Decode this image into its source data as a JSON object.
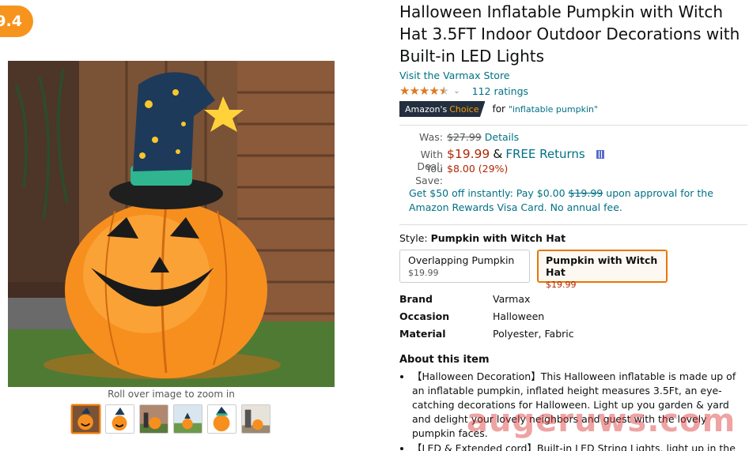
{
  "badge": {
    "score": "9.4"
  },
  "product": {
    "title": "Halloween Inflatable Pumpkin with Witch Hat 3.5FT Indoor Outdoor Decorations with Built-in LED Lights",
    "store_link": "Visit the Varmax Store",
    "rating_value": 4.5,
    "rating_count": "112 ratings",
    "choice_label_1": "Amazon's",
    "choice_label_2": "Choice",
    "choice_for": "for",
    "choice_keyword": "\"inflatable pumpkin\""
  },
  "pricing": {
    "was_label": "Was:",
    "was_price": "$27.99",
    "details_link": "Details",
    "deal_label": "With Deal:",
    "deal_price": "$19.99",
    "amp": "&",
    "free_returns": "FREE Returns",
    "save_label": "You Save:",
    "save_value": "$8.00 (29%)"
  },
  "promo": {
    "text_before": "Get $50 off instantly: Pay $0.00",
    "strike_price": "$19.99",
    "text_after": "upon approval for the Amazon Rewards Visa Card. No annual fee."
  },
  "style": {
    "label": "Style:",
    "selected": "Pumpkin with Witch Hat",
    "options": [
      {
        "name": "Overlapping Pumpkin",
        "price": "$19.99"
      },
      {
        "name": "Pumpkin with Witch Hat",
        "price": "$19.99"
      }
    ]
  },
  "specs": [
    {
      "key": "Brand",
      "value": "Varmax"
    },
    {
      "key": "Occasion",
      "value": "Halloween"
    },
    {
      "key": "Material",
      "value": "Polyester, Fabric"
    }
  ],
  "about": {
    "title": "About this item",
    "bullets": [
      "【Halloween Decoration】This Halloween inflatable is made up of an inflatable pumpkin, inflated height measures 3.5Ft, an eye-catching decorations for Halloween. Light up you garden & yard and delight your lovely neighbors and guest with the lovely pumpkin faces.",
      "【LED & Extended cord】Built-in LED String Lights, light up in the Evening"
    ]
  },
  "gallery": {
    "zoom_hint": "Roll over image to zoom in",
    "thumb_count": 6
  },
  "watermark": "augeruws.com",
  "colors": {
    "badge": "#f7941d",
    "link": "#007185",
    "price": "#b12704",
    "star": "#de7921",
    "choice_bg": "#232f3e",
    "selected_border": "#e77600"
  }
}
